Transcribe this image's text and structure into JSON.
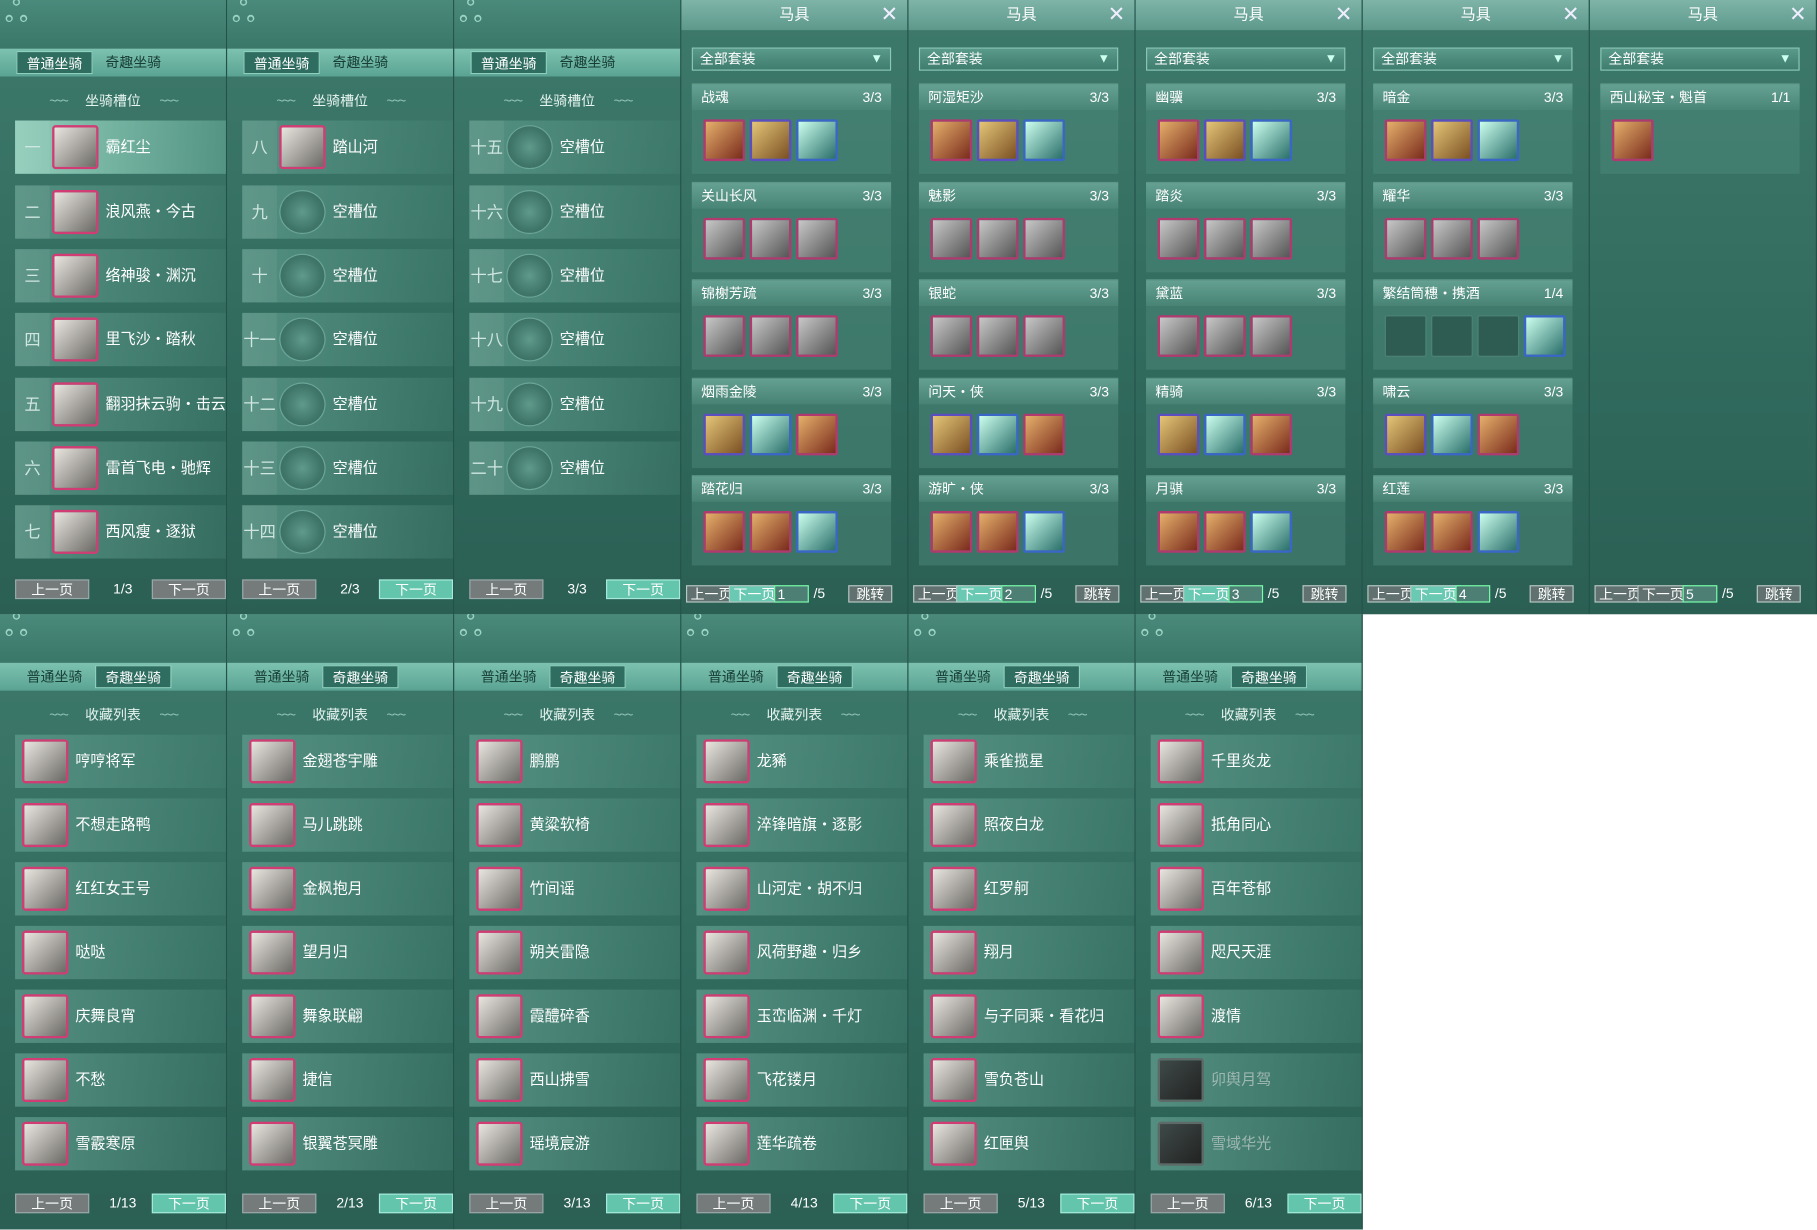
{
  "tabs": {
    "normal": "普通坐骑",
    "special": "奇趣坐骑"
  },
  "slot_section_title": "坐骑槽位",
  "favorites_title": "收藏列表",
  "pager": {
    "prev": "上一页",
    "next": "下一页",
    "jump": "跳转"
  },
  "mount_pages": [
    {
      "page": "1/3",
      "rows": [
        {
          "num": "一",
          "name": "霸红尘"
        },
        {
          "num": "二",
          "name": "浪风燕・今古"
        },
        {
          "num": "三",
          "name": "络神骏・渊沉"
        },
        {
          "num": "四",
          "name": "里飞沙・踏秋"
        },
        {
          "num": "五",
          "name": "翻羽抹云驹・击云"
        },
        {
          "num": "六",
          "name": "雷首飞电・驰辉"
        },
        {
          "num": "七",
          "name": "西风瘦・逐狱"
        }
      ]
    },
    {
      "page": "2/3",
      "rows": [
        {
          "num": "八",
          "name": "踏山河"
        },
        {
          "num": "九",
          "name": "空槽位"
        },
        {
          "num": "十",
          "name": "空槽位"
        },
        {
          "num": "十一",
          "name": "空槽位"
        },
        {
          "num": "十二",
          "name": "空槽位"
        },
        {
          "num": "十三",
          "name": "空槽位"
        },
        {
          "num": "十四",
          "name": "空槽位"
        }
      ]
    },
    {
      "page": "3/3",
      "rows": [
        {
          "num": "十五",
          "name": "空槽位"
        },
        {
          "num": "十六",
          "name": "空槽位"
        },
        {
          "num": "十七",
          "name": "空槽位"
        },
        {
          "num": "十八",
          "name": "空槽位"
        },
        {
          "num": "十九",
          "name": "空槽位"
        },
        {
          "num": "二十",
          "name": "空槽位"
        }
      ]
    }
  ],
  "gear_title": "马具",
  "gear_filter": "全部套装",
  "gear_pages": [
    {
      "page": "1",
      "total": "/5",
      "sets": [
        {
          "name": "战魂",
          "count": "3/3"
        },
        {
          "name": "关山长风",
          "count": "3/3"
        },
        {
          "name": "锦榭芳疏",
          "count": "3/3"
        },
        {
          "name": "烟雨金陵",
          "count": "3/3"
        },
        {
          "name": "踏花归",
          "count": "3/3"
        }
      ]
    },
    {
      "page": "2",
      "total": "/5",
      "sets": [
        {
          "name": "阿湿矩沙",
          "count": "3/3"
        },
        {
          "name": "魅影",
          "count": "3/3"
        },
        {
          "name": "银蛇",
          "count": "3/3"
        },
        {
          "name": "问天・侠",
          "count": "3/3"
        },
        {
          "name": "游旷・侠",
          "count": "3/3"
        }
      ]
    },
    {
      "page": "3",
      "total": "/5",
      "sets": [
        {
          "name": "幽骥",
          "count": "3/3"
        },
        {
          "name": "踏炎",
          "count": "3/3"
        },
        {
          "name": "黛蓝",
          "count": "3/3"
        },
        {
          "name": "精骑",
          "count": "3/3"
        },
        {
          "name": "月骐",
          "count": "3/3"
        }
      ]
    },
    {
      "page": "4",
      "total": "/5",
      "sets": [
        {
          "name": "暗金",
          "count": "3/3"
        },
        {
          "name": "耀华",
          "count": "3/3"
        },
        {
          "name": "繁结筒穗・携酒",
          "count": "1/4"
        },
        {
          "name": "啸云",
          "count": "3/3"
        },
        {
          "name": "红莲",
          "count": "3/3"
        }
      ]
    },
    {
      "page": "5",
      "total": "/5",
      "sets": [
        {
          "name": "西山秘宝・魁首",
          "count": "1/1"
        }
      ]
    }
  ],
  "fav_pages": [
    {
      "page": "1/13",
      "items": [
        "哼哼将军",
        "不想走路鸭",
        "红红女王号",
        "哒哒",
        "庆舞良宵",
        "不愁",
        "雪霰寒原"
      ]
    },
    {
      "page": "2/13",
      "items": [
        "金翅苍宇雕",
        "马儿跳跳",
        "金枫抱月",
        "望月归",
        "舞象联翩",
        "捷信",
        "银翼苍冥雕"
      ]
    },
    {
      "page": "3/13",
      "items": [
        "鹏鹏",
        "黄粱软椅",
        "竹间谣",
        "朔关雷隐",
        "霞醴碎香",
        "西山拂雪",
        "瑶境宸游"
      ]
    },
    {
      "page": "4/13",
      "items": [
        "龙豨",
        "淬锋暗旗・逐影",
        "山河定・胡不归",
        "风荷野趣・归乡",
        "玉峦临渊・千灯",
        "飞花镂月",
        "莲华疏卷"
      ]
    },
    {
      "page": "5/13",
      "items": [
        "乘雀揽星",
        "照夜白龙",
        "红罗舸",
        "翔月",
        "与子同乘・看花归",
        "雪负苍山",
        "红匣舆"
      ]
    },
    {
      "page": "6/13",
      "items": [
        "千里炎龙",
        "抵角同心",
        "百年苍郁",
        "咫尺天涯",
        "渡情",
        "卯舆月驾",
        "雪域华光"
      ]
    }
  ]
}
